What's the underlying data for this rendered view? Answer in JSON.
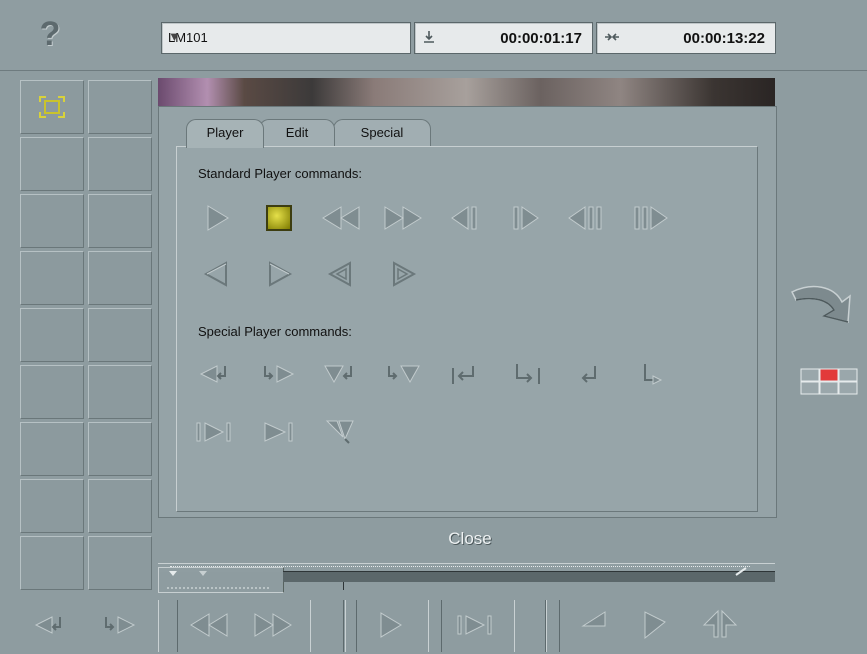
{
  "header": {
    "help_glyph": "?",
    "clip_name": "LM101",
    "dropdown_glyph": "▼",
    "tc_in_icon": "download-icon",
    "tc_in": "00:00:01:17",
    "tc_dur_icon": "inout-icon",
    "tc_duration": "00:00:13:22"
  },
  "tabs": [
    {
      "label": "Player",
      "active": true
    },
    {
      "label": "Edit",
      "active": false
    },
    {
      "label": "Special",
      "active": false
    }
  ],
  "player_tab": {
    "standard_label": "Standard Player commands:",
    "special_label": "Special Player commands:",
    "standard_buttons": [
      "play",
      "stop",
      "rewind",
      "fast-forward",
      "step-back",
      "step-forward",
      "shuttle-back",
      "shuttle-forward",
      "jog-back",
      "jog-forward",
      "slow-back",
      "slow-forward"
    ],
    "special_buttons": [
      "mark-in-back",
      "mark-in-forward",
      "mark-out-back",
      "mark-out-forward",
      "go-to-in",
      "go-to-out",
      "return",
      "loop",
      "play-to-end",
      "go-to-end",
      "trim"
    ]
  },
  "close_label": "Close",
  "colors": {
    "accent": "#e23a3a",
    "stop_fill": "#c9c32c",
    "background": "#8e9ca0"
  }
}
